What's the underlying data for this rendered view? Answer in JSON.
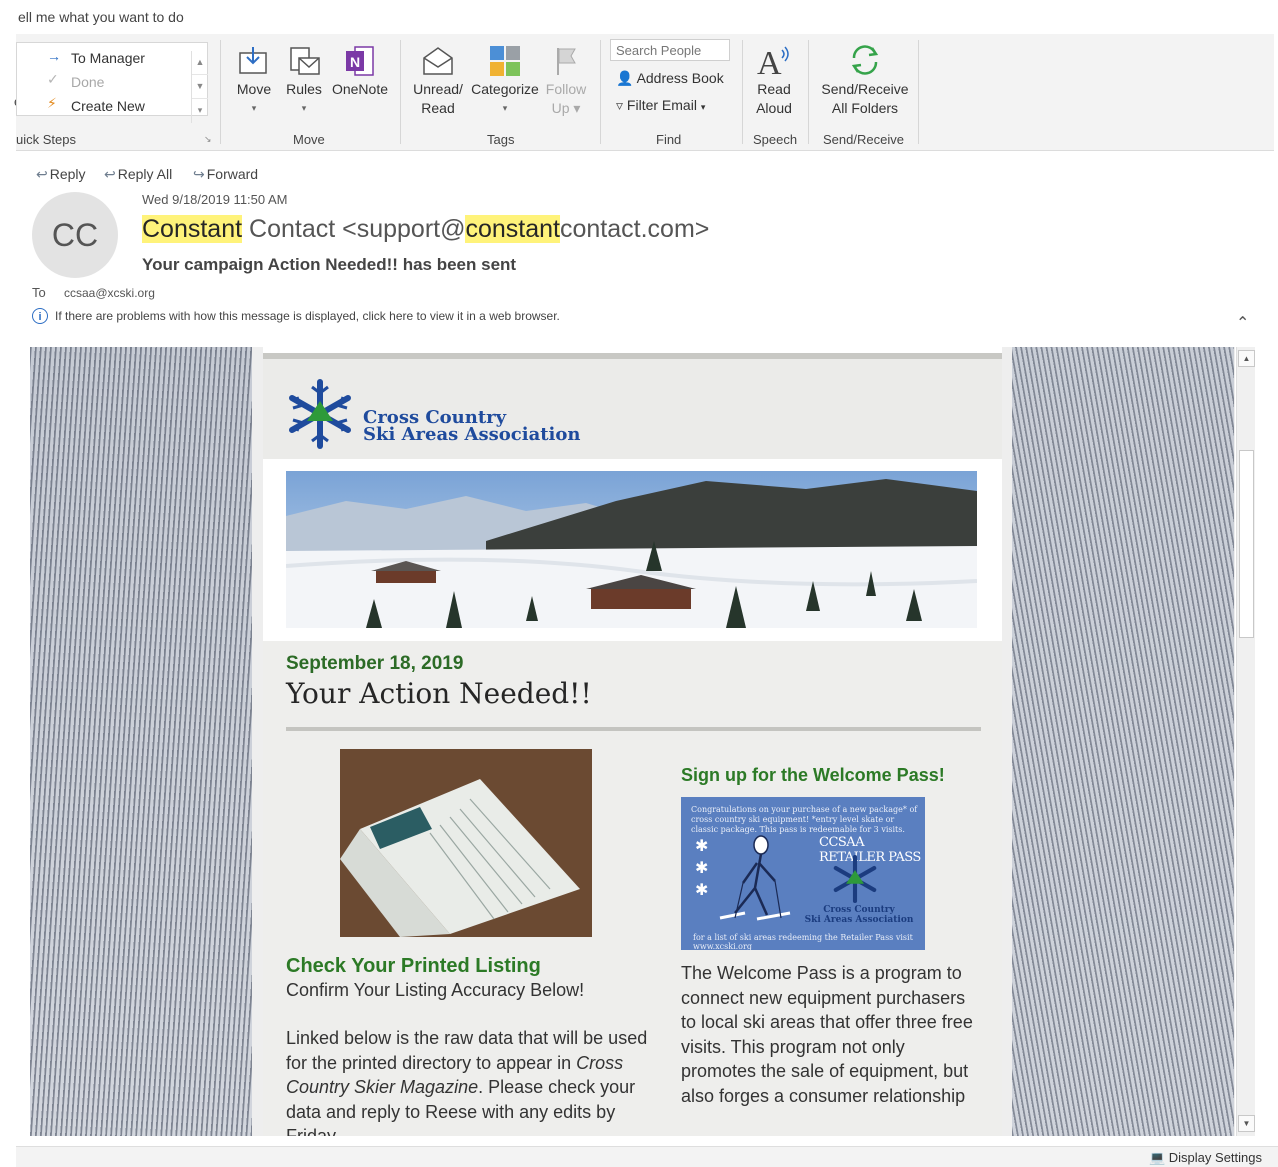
{
  "tell_me": "ell me what you want to do",
  "quick_steps": {
    "items": [
      {
        "icon": "arrow-right-icon",
        "label": "To Manager",
        "enabled": true
      },
      {
        "icon": "check-icon",
        "label": "Done",
        "enabled": false
      },
      {
        "icon": "lightning-icon",
        "label": "Create New",
        "enabled": true
      }
    ],
    "left_clip": "e",
    "group_label": "uick Steps"
  },
  "move_group": {
    "move": "Move",
    "rules": "Rules",
    "onenote": "OneNote",
    "label": "Move"
  },
  "tags_group": {
    "unread": "Unread/",
    "unread2": "Read",
    "categorize": "Categorize",
    "follow": "Follow",
    "follow2": "Up",
    "label": "Tags"
  },
  "find_group": {
    "search_placeholder": "Search People",
    "address_book": "Address Book",
    "filter_email": "Filter Email",
    "label": "Find"
  },
  "speech_group": {
    "read": "Read",
    "aloud": "Aloud",
    "label": "Speech"
  },
  "sendreceive_group": {
    "line1": "Send/Receive",
    "line2": "All Folders",
    "label": "Send/Receive"
  },
  "actions": {
    "reply": "Reply",
    "reply_all": "Reply All",
    "forward": "Forward"
  },
  "message": {
    "avatar_initials": "CC",
    "date": "Wed 9/18/2019 11:50 AM",
    "sender_p1": "Constant",
    "sender_p2": " Contact <support@",
    "sender_p3": "constant",
    "sender_p4": "contact.com>",
    "subject": "Your campaign Action Needed!! has been sent",
    "to_label": "To",
    "to_value": "ccsaa@xcski.org",
    "info": "If there are problems with how this message is displayed, click here to view it in a web browser."
  },
  "email": {
    "logo_line1": "Cross Country",
    "logo_line2": "Ski Areas Association",
    "date": "September 18, 2019",
    "headline": "Your Action Needed!!",
    "left_heading": "Check Your Printed Listing",
    "left_sub": "Confirm Your Listing Accuracy Below!",
    "left_p_a": "Linked below is the raw data that will be used for the printed directory to appear in ",
    "left_p_em1": "Cross Country Skier Magazine",
    "left_p_b": ". Please check your data and reply to Reese with any edits by Friday",
    "right_heading": "Sign up for the Welcome Pass!",
    "pass_head": "Congratulations on your purchase of a new package* of cross country ski equipment! *entry level skate or classic package. This pass is redeemable for 3 visits.",
    "pass_title": "CCSAA RETAILER PASS",
    "pass_org1": "Cross Country",
    "pass_org2": "Ski Areas Association",
    "pass_foot": "for a list of ski areas redeeming the Retailer Pass visit www.xcski.org",
    "right_p": "The Welcome Pass is a program to connect new equipment purchasers to local ski areas that offer three free visits. This program not only promotes the sale of equipment, but also forges a consumer relationship"
  },
  "status": {
    "display_settings": "Display Settings"
  }
}
